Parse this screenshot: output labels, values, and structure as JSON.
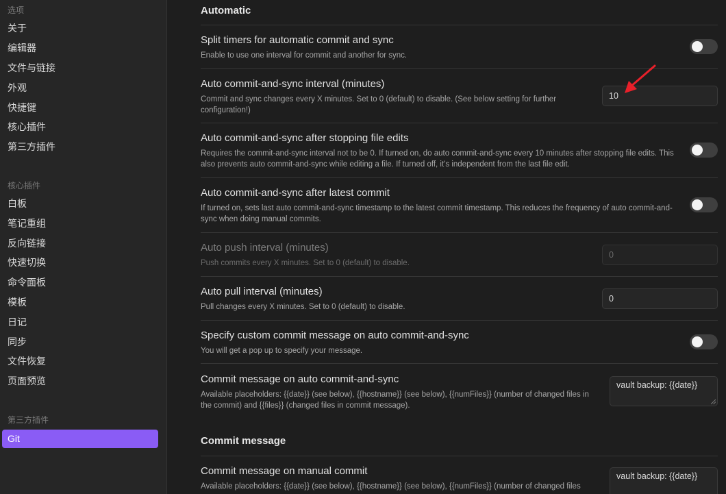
{
  "sidebar": {
    "groups": [
      {
        "title": "选项",
        "items": [
          "关于",
          "编辑器",
          "文件与链接",
          "外观",
          "快捷键",
          "核心插件",
          "第三方插件"
        ]
      },
      {
        "title": "核心插件",
        "items": [
          "白板",
          "笔记重组",
          "反向链接",
          "快速切换",
          "命令面板",
          "模板",
          "日记",
          "同步",
          "文件恢复",
          "页面预览"
        ]
      },
      {
        "title": "第三方插件",
        "items": [
          "Git"
        ]
      }
    ],
    "active_item": "Git"
  },
  "main": {
    "sections": {
      "automatic": "Automatic",
      "commit_message": "Commit message"
    },
    "settings": {
      "split_timers": {
        "name": "Split timers for automatic commit and sync",
        "desc": "Enable to use one interval for commit and another for sync.",
        "enabled": false
      },
      "auto_sync_interval": {
        "name": "Auto commit-and-sync interval (minutes)",
        "desc": "Commit and sync changes every X minutes. Set to 0 (default) to disable. (See below setting for further configuration!)",
        "value": "10"
      },
      "after_stopping_edits": {
        "name": "Auto commit-and-sync after stopping file edits",
        "desc": "Requires the commit-and-sync interval not to be 0. If turned on, do auto commit-and-sync every 10 minutes after stopping file edits. This also prevents auto commit-and-sync while editing a file. If turned off, it's independent from the last file edit.",
        "enabled": false
      },
      "after_latest_commit": {
        "name": "Auto commit-and-sync after latest commit",
        "desc": "If turned on, sets last auto commit-and-sync timestamp to the latest commit timestamp. This reduces the frequency of auto commit-and-sync when doing manual commits.",
        "enabled": false
      },
      "auto_push_interval": {
        "name": "Auto push interval (minutes)",
        "desc": "Push commits every X minutes. Set to 0 (default) to disable.",
        "placeholder": "0",
        "disabled": true
      },
      "auto_pull_interval": {
        "name": "Auto pull interval (minutes)",
        "desc": "Pull changes every X minutes. Set to 0 (default) to disable.",
        "value": "0"
      },
      "custom_commit_message": {
        "name": "Specify custom commit message on auto commit-and-sync",
        "desc": "You will get a pop up to specify your message.",
        "enabled": false
      },
      "auto_commit_message": {
        "name": "Commit message on auto commit-and-sync",
        "desc": "Available placeholders: {{date}} (see below), {{hostname}} (see below), {{numFiles}} (number of changed files in the commit) and {{files}} (changed files in commit message).",
        "value": "vault backup: {{date}}"
      },
      "manual_commit_message": {
        "name": "Commit message on manual commit",
        "desc": "Available placeholders: {{date}} (see below), {{hostname}} (see below), {{numFiles}} (number of changed files",
        "value": "vault backup: {{date}}"
      }
    }
  },
  "colors": {
    "accent": "#8a5cf5",
    "annotation_arrow": "#e8202a"
  }
}
